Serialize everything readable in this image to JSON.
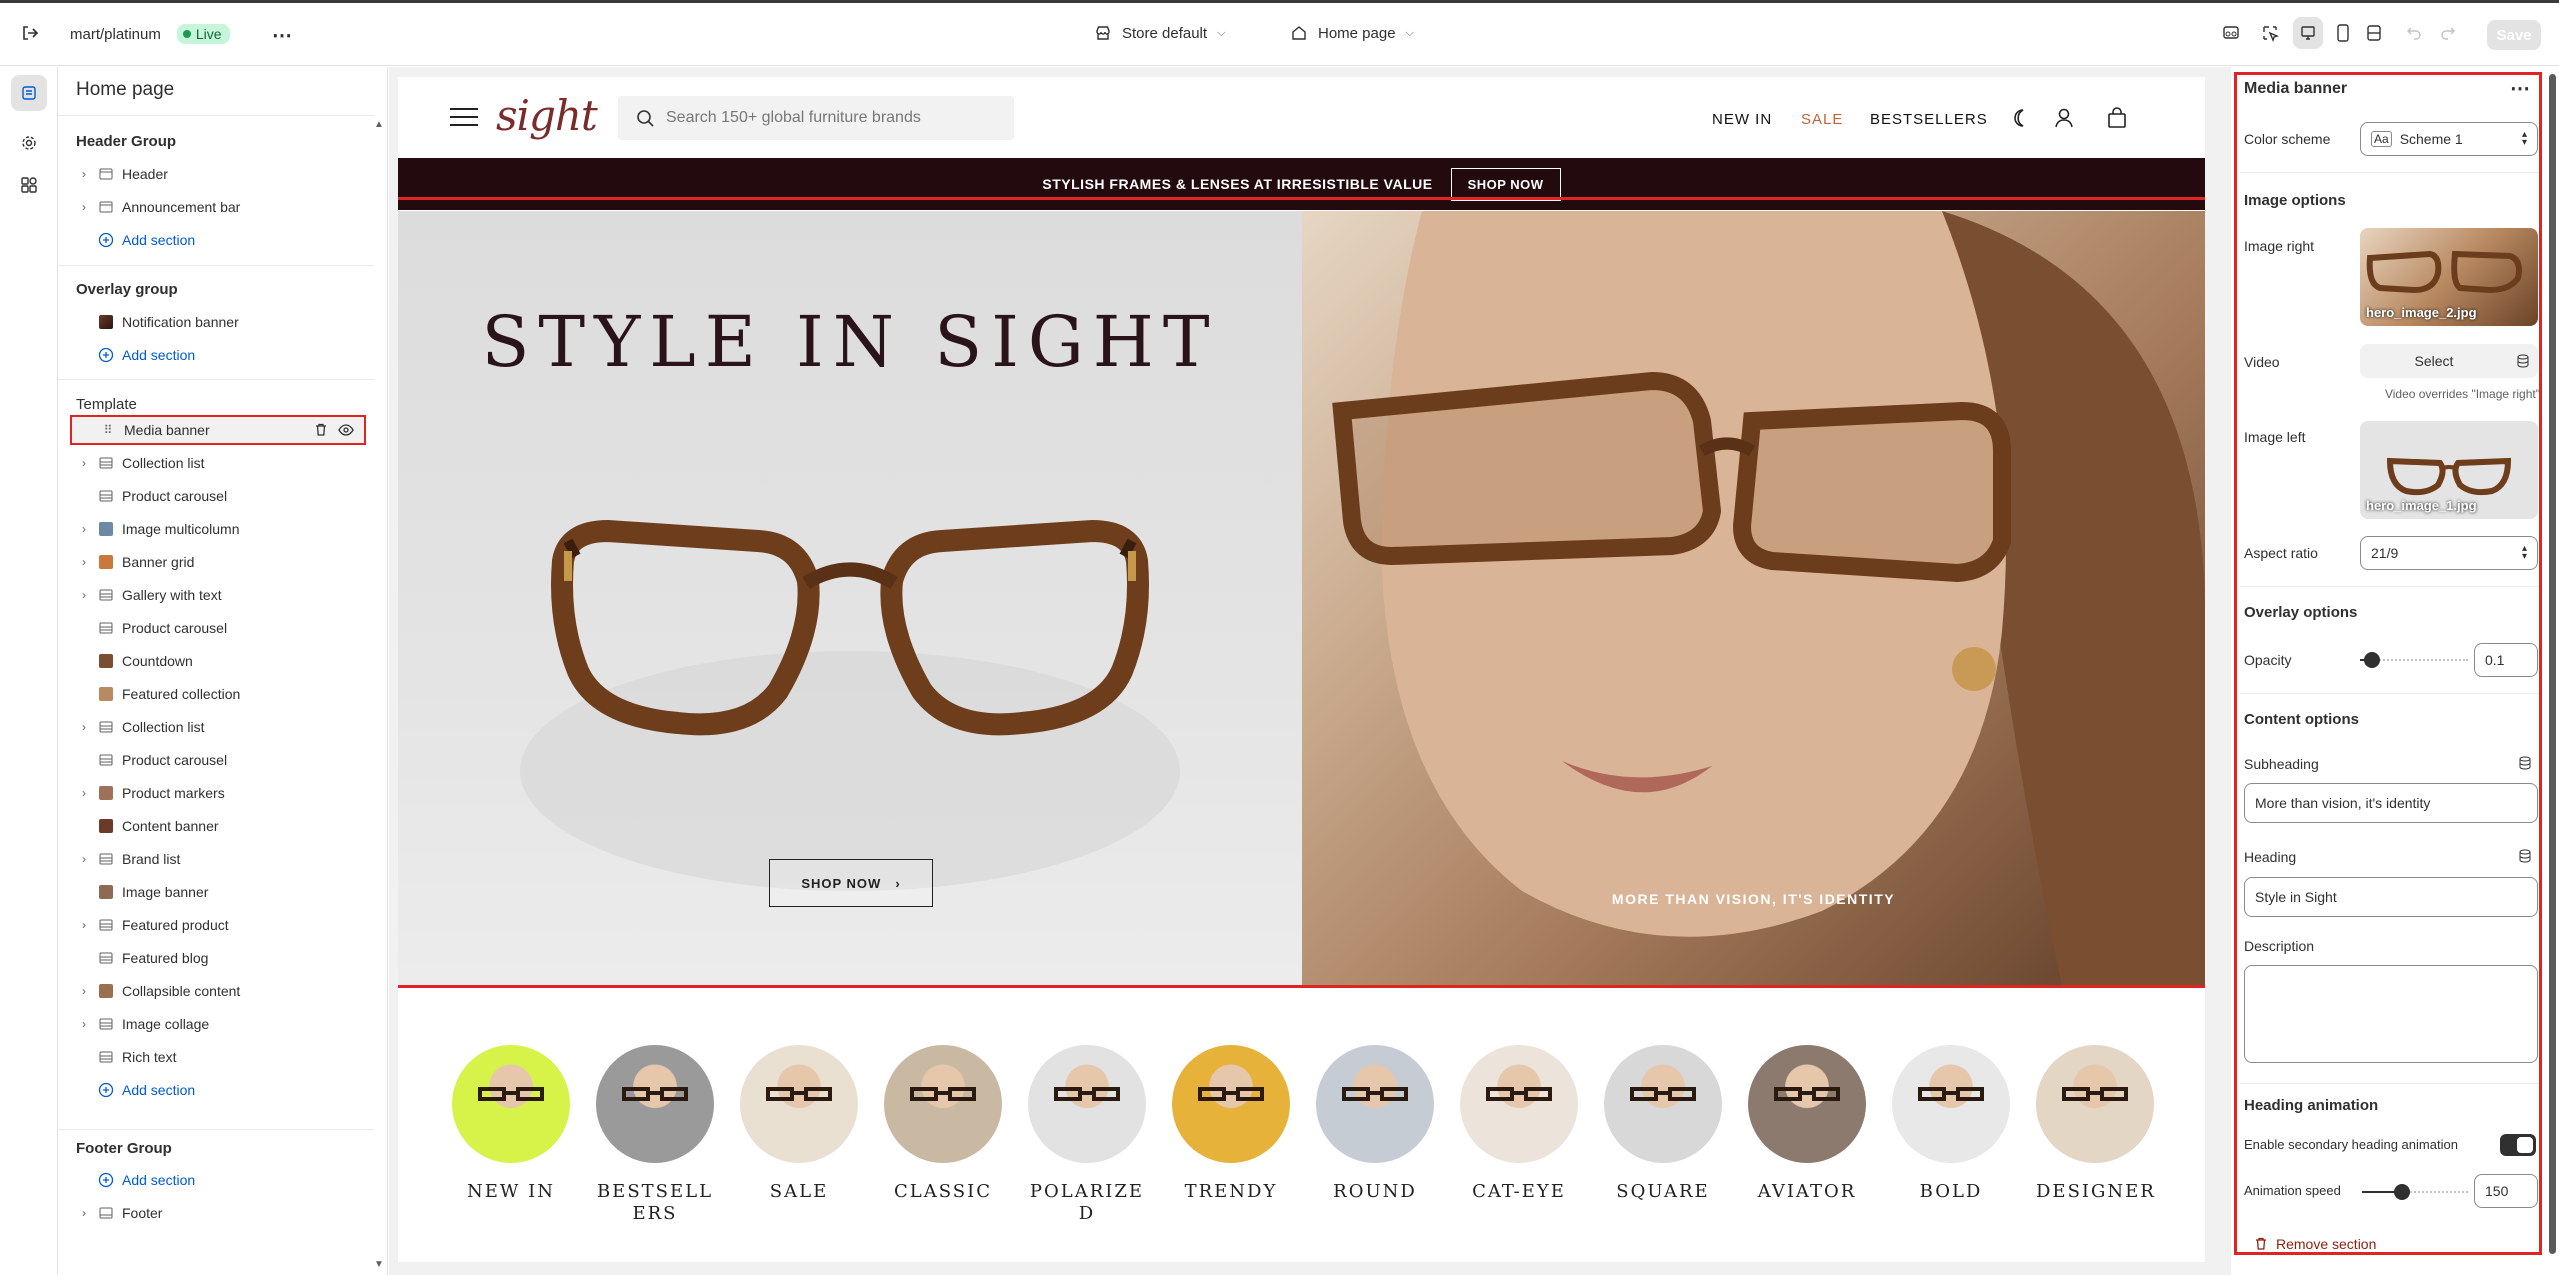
{
  "topbar": {
    "store_path": "mart/platinum",
    "live_label": "Live",
    "theme_select": "Store default",
    "page_select": "Home page",
    "save_label": "Save"
  },
  "left_panel": {
    "title": "Home page",
    "header_group": {
      "title": "Header Group",
      "items": [
        "Header",
        "Announcement bar"
      ],
      "add_label": "Add section"
    },
    "overlay_group": {
      "title": "Overlay group",
      "items": [
        "Notification banner"
      ],
      "add_label": "Add section"
    },
    "template": {
      "title": "Template",
      "selected": "Media banner",
      "items": [
        "Collection list",
        "Product carousel",
        "Image multicolumn",
        "Banner grid",
        "Gallery with text",
        "Product carousel",
        "Countdown",
        "Featured collection",
        "Collection list",
        "Product carousel",
        "Product markers",
        "Content banner",
        "Brand list",
        "Image banner",
        "Featured product",
        "Featured blog",
        "Collapsible content",
        "Image collage",
        "Rich text"
      ],
      "add_label": "Add section"
    },
    "footer_group": {
      "title": "Footer Group",
      "add_label": "Add section",
      "items": [
        "Footer"
      ]
    }
  },
  "store": {
    "logo": "sight",
    "search_placeholder": "Search 150+ global furniture brands",
    "nav": [
      "NEW IN",
      "SALE",
      "BESTSELLERS"
    ],
    "sale_color": "#c0643a",
    "promo_text": "STYLISH FRAMES & LENSES AT IRRESISTIBLE VALUE",
    "promo_button": "SHOP NOW",
    "hero_title": "STYLE IN SIGHT",
    "hero_button": "SHOP NOW",
    "hero_subheading": "MORE THAN VISION, IT'S IDENTITY",
    "categories": [
      "NEW IN",
      "BESTSELL ERS",
      "SALE",
      "CLASSIC",
      "POLARIZE D",
      "TRENDY",
      "ROUND",
      "CAT-EYE",
      "SQUARE",
      "AVIATOR",
      "BOLD",
      "DESIGNER"
    ]
  },
  "settings": {
    "title": "Media banner",
    "color_scheme_label": "Color scheme",
    "color_scheme_value": "Scheme 1",
    "image_options": "Image options",
    "image_right_label": "Image right",
    "image_right_file": "hero_image_2.jpg",
    "video_label": "Video",
    "video_select": "Select",
    "video_hint": "Video overrides \"Image right\"",
    "image_left_label": "Image left",
    "image_left_file": "hero_image_1.jpg",
    "aspect_ratio_label": "Aspect ratio",
    "aspect_ratio_value": "21/9",
    "overlay_options": "Overlay options",
    "opacity_label": "Opacity",
    "opacity_value": "0.1",
    "content_options": "Content options",
    "subheading_label": "Subheading",
    "subheading_value": "More than vision, it's identity",
    "heading_label": "Heading",
    "heading_value": "Style in Sight",
    "description_label": "Description",
    "heading_animation": "Heading animation",
    "secondary_anim_label": "Enable secondary heading animation",
    "anim_speed_label": "Animation speed",
    "anim_speed_value": "150",
    "remove_label": "Remove section"
  }
}
